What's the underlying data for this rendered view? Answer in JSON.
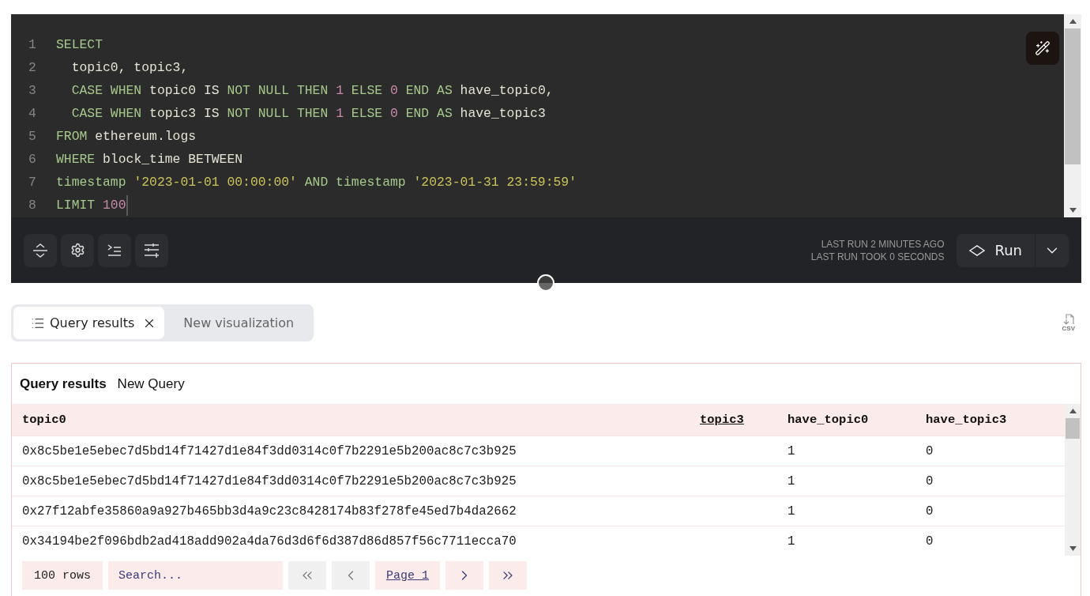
{
  "editor": {
    "lines": [
      {
        "number": "1",
        "cursor": false,
        "tokens": [
          {
            "kind": "keyword",
            "t": "SELECT"
          }
        ]
      },
      {
        "number": "2",
        "cursor": false,
        "tokens": [
          {
            "kind": "identifier",
            "t": "  topic0, topic3,"
          }
        ]
      },
      {
        "number": "3",
        "cursor": false,
        "tokens": [
          {
            "kind": "keyword",
            "t": "  CASE WHEN "
          },
          {
            "kind": "identifier",
            "t": "topic0 IS "
          },
          {
            "kind": "keyword",
            "t": "NOT NULL THEN "
          },
          {
            "kind": "number",
            "t": "1"
          },
          {
            "kind": "keyword",
            "t": " ELSE "
          },
          {
            "kind": "number",
            "t": "0"
          },
          {
            "kind": "keyword",
            "t": " END AS "
          },
          {
            "kind": "identifier",
            "t": "have_topic0,"
          }
        ]
      },
      {
        "number": "4",
        "cursor": false,
        "tokens": [
          {
            "kind": "keyword",
            "t": "  CASE WHEN "
          },
          {
            "kind": "identifier",
            "t": "topic3 IS "
          },
          {
            "kind": "keyword",
            "t": "NOT NULL THEN "
          },
          {
            "kind": "number",
            "t": "1"
          },
          {
            "kind": "keyword",
            "t": " ELSE "
          },
          {
            "kind": "number",
            "t": "0"
          },
          {
            "kind": "keyword",
            "t": " END AS "
          },
          {
            "kind": "identifier",
            "t": "have_topic3"
          }
        ]
      },
      {
        "number": "5",
        "cursor": false,
        "tokens": [
          {
            "kind": "keyword",
            "t": "FROM "
          },
          {
            "kind": "identifier",
            "t": "ethereum.logs"
          }
        ]
      },
      {
        "number": "6",
        "cursor": false,
        "tokens": [
          {
            "kind": "keyword",
            "t": "WHERE "
          },
          {
            "kind": "identifier",
            "t": "block_time BETWEEN"
          }
        ]
      },
      {
        "number": "7",
        "cursor": false,
        "tokens": [
          {
            "kind": "keyword",
            "t": "timestamp "
          },
          {
            "kind": "string",
            "t": "'2023-01-01 00:00:00'"
          },
          {
            "kind": "keyword",
            "t": " AND timestamp "
          },
          {
            "kind": "string",
            "t": "'2023-01-31 23:59:59'"
          }
        ]
      },
      {
        "number": "8",
        "cursor": true,
        "tokens": [
          {
            "kind": "keyword",
            "t": "LIMIT "
          },
          {
            "kind": "number",
            "t": "100"
          }
        ]
      }
    ],
    "toolbar_buttons": [
      {
        "kind": "fold"
      },
      {
        "kind": "settings"
      },
      {
        "kind": "indent"
      },
      {
        "kind": "sliders"
      }
    ],
    "last_run": "LAST RUN 2 MINUTES AGO",
    "last_run_duration": "LAST RUN TOOK 0 SECONDS",
    "run_button": "Run"
  },
  "result_tabs": [
    {
      "label": "Query results",
      "selected": true,
      "closable": true
    },
    {
      "label": "New visualization",
      "selected": false,
      "closable": false
    }
  ],
  "export_icon_text": "CSV",
  "results": {
    "title": "Query results",
    "query_name": "New Query",
    "columns": [
      {
        "label": "topic0",
        "sorted": false
      },
      {
        "label": "topic3",
        "sorted": true
      },
      {
        "label": "have_topic0",
        "sorted": false
      },
      {
        "label": "have_topic3",
        "sorted": false
      }
    ],
    "rows": [
      [
        "0x8c5be1e5ebec7d5bd14f71427d1e84f3dd0314c0f7b2291e5b200ac8c7c3b925",
        null,
        "1",
        "0"
      ],
      [
        "0x8c5be1e5ebec7d5bd14f71427d1e84f3dd0314c0f7b2291e5b200ac8c7c3b925",
        null,
        "1",
        "0"
      ],
      [
        "0x27f12abfe35860a9a927b465bb3d4a9c23c8428174b83f278fe45ed7b4da2662",
        null,
        "1",
        "0"
      ],
      [
        "0x34194be2f096bdb2ad418add902a4da76d3d6f6d387d86d857f56c7711ecca70",
        null,
        "1",
        "0"
      ]
    ],
    "row_count": "100 rows",
    "search": {
      "placeholder": "Search..."
    },
    "pager": [
      {
        "kind": "first",
        "disabled": true
      },
      {
        "kind": "prev",
        "disabled": true
      },
      {
        "kind": "page",
        "label": "Page 1",
        "disabled": false
      },
      {
        "kind": "next",
        "disabled": false
      },
      {
        "kind": "last",
        "disabled": false
      }
    ]
  }
}
